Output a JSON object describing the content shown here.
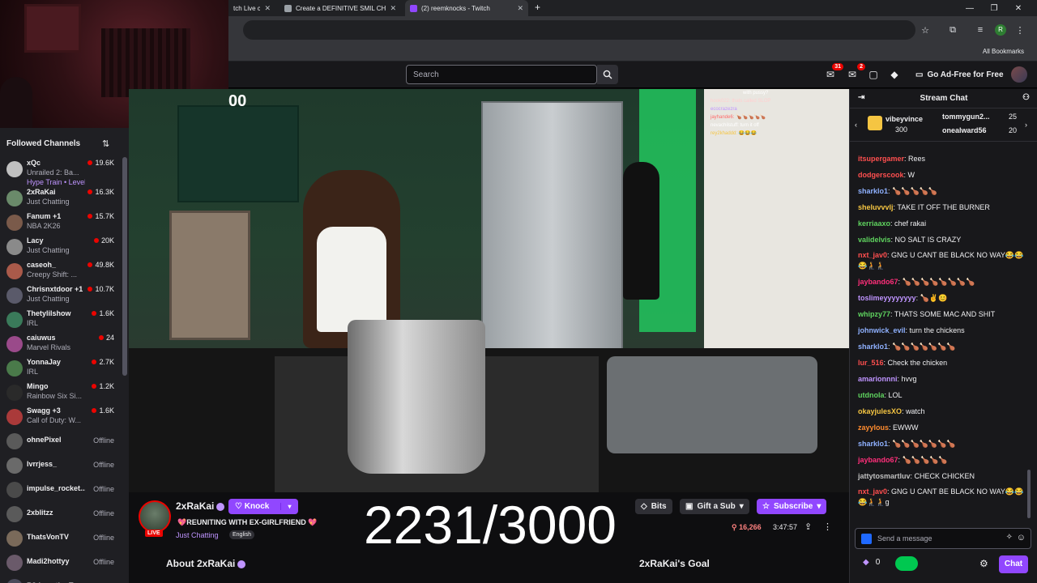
{
  "browser": {
    "tabs": [
      {
        "title": "tch Live c"
      },
      {
        "title": "Create a DEFINITIVE SMIL CHAR"
      },
      {
        "title": "(2) reemknocks - Twitch"
      }
    ],
    "all_bookmarks": "All Bookmarks",
    "profile_initial": "R"
  },
  "topnav": {
    "search_placeholder": "Search",
    "notif_badge_1": "31",
    "notif_badge_2": "2",
    "ad_free": "Go Ad-Free for Free"
  },
  "sidebar": {
    "title": "Followed Channels",
    "channels": [
      {
        "name": "xQc",
        "game": "Unrailed 2: Ba...",
        "viewers": "19.6K",
        "extra": "Hype Train • Level 2",
        "color": "#c0c0c0"
      },
      {
        "name": "2xRaKai",
        "game": "Just Chatting",
        "viewers": "16.3K",
        "color": "#6a8a6a"
      },
      {
        "name": "Fanum +1",
        "game": "NBA 2K26",
        "viewers": "15.7K",
        "color": "#7a5a4a"
      },
      {
        "name": "Lacy",
        "game": "Just Chatting",
        "viewers": "20K",
        "color": "#8a8a8a"
      },
      {
        "name": "caseoh_",
        "game": "Creepy Shift: ...",
        "viewers": "49.8K",
        "color": "#aa5a4a"
      },
      {
        "name": "Chrisnxtdoor +1",
        "game": "Just Chatting",
        "viewers": "10.7K",
        "color": "#5a5a6a"
      },
      {
        "name": "Thetylilshow",
        "game": "IRL",
        "viewers": "1.6K",
        "color": "#3a7a5a"
      },
      {
        "name": "caiuwus",
        "game": "Marvel Rivals",
        "viewers": "24",
        "color": "#9a4a8a"
      },
      {
        "name": "YonnaJay",
        "game": "IRL",
        "viewers": "2.7K",
        "color": "#4a7a4a"
      },
      {
        "name": "Mingo",
        "game": "Rainbow Six Si...",
        "viewers": "1.2K",
        "color": "#2a2a2a"
      },
      {
        "name": "Swagg +3",
        "game": "Call of Duty: W...",
        "viewers": "1.6K",
        "color": "#aa3a3a"
      },
      {
        "name": "ohnePixel",
        "offline": "Offline",
        "color": "#5a5a5a"
      },
      {
        "name": "lvrrjess_",
        "offline": "Offline",
        "color": "#6a6a6a"
      },
      {
        "name": "impulse_rocket...",
        "offline": "Offline",
        "color": "#4a4a4a"
      },
      {
        "name": "2xblitzz",
        "offline": "Offline",
        "color": "#5a5a5a"
      },
      {
        "name": "ThatsVonTV",
        "offline": "Offline",
        "color": "#7a6a5a"
      },
      {
        "name": "Madi2hottyy",
        "offline": "Offline",
        "color": "#6a5a6a"
      },
      {
        "name": "R3demptionT",
        "offline": "Offline",
        "color": "#4a4a5a"
      }
    ]
  },
  "video": {
    "corner_number": "00",
    "overlay_chat": [
      "with pussy?",
      "hook022: thats called SLOP",
      "ecocrazezra",
      "jayhande6: 🍗🍗🍗🍗🍗",
      "nevachilstuff: turn it off",
      "rey2khaddd: 😂😂😂"
    ]
  },
  "stream": {
    "streamer": "2xRaKai",
    "live": "LIVE",
    "knock": "Knock",
    "title": "💖REUNITING WITH EX-GIRLFRIEND 💖",
    "category": "Just Chatting",
    "language": "English",
    "big_counter": "2231/3000",
    "bits": "Bits",
    "gift_sub": "Gift a Sub",
    "subscribe": "Subscribe",
    "viewers": "16,266",
    "uptime": "3:47:57",
    "about": "About 2xRaKai",
    "goal": "2xRaKai's Goal"
  },
  "chat": {
    "header": "Stream Chat",
    "gifters": [
      {
        "name": "vibeyvince",
        "count": "300"
      },
      {
        "name": "tommygun2...",
        "count": "25"
      },
      {
        "name": "onealward56",
        "count": "20"
      }
    ],
    "messages": [
      {
        "user": "itsupergamer",
        "text": "Rees",
        "color": "#ff4f4f"
      },
      {
        "user": "dodgerscook",
        "text": "W",
        "color": "#ff4f4f"
      },
      {
        "user": "sharklo1",
        "text": "🍗🍗🍗🍗🍗",
        "color": "#8fb1ff"
      },
      {
        "user": "sheluvvvlj",
        "text": "TAKE IT OFF THE BURNER",
        "color": "#f5c542"
      },
      {
        "user": "kerriaaxo",
        "text": "chef rakai",
        "color": "#5fd35f"
      },
      {
        "user": "validelvis",
        "text": "NO SALT IS CRAZY",
        "color": "#5fd35f"
      },
      {
        "user": "nxt_jav0",
        "text": "GNG U CANT BE BLACK NO WAY😂😂😂🧎🧎",
        "color": "#ff4f4f"
      },
      {
        "user": "jaybando67",
        "text": "🍗🍗🍗🍗🍗🍗🍗🍗",
        "color": "#ff2f7a"
      },
      {
        "user": "toslimeyyyyyyyy",
        "text": "🍗✌😊",
        "color": "#bf94ff"
      },
      {
        "user": "whipzy77",
        "text": "THATS SOME MAC AND SHIT",
        "color": "#5fd35f"
      },
      {
        "user": "johnwick_evil",
        "text": "turn the chickens",
        "color": "#8fb1ff"
      },
      {
        "user": "sharklo1",
        "text": "🍗🍗🍗🍗🍗🍗🍗",
        "color": "#8fb1ff"
      },
      {
        "user": "lur_516",
        "text": "Check the chicken",
        "color": "#ff4f4f"
      },
      {
        "user": "amarionnni",
        "text": "hvvg",
        "color": "#bf94ff"
      },
      {
        "user": "utdnola",
        "text": "LOL",
        "color": "#5fd35f"
      },
      {
        "user": "okayjulesXO",
        "text": "watch",
        "color": "#f5c542"
      },
      {
        "user": "zayylous",
        "text": "EWWW",
        "color": "#ff8c2f"
      },
      {
        "user": "sharklo1",
        "text": "🍗🍗🍗🍗🍗🍗🍗",
        "color": "#8fb1ff"
      },
      {
        "user": "jaybando67",
        "text": "🍗🍗🍗🍗🍗",
        "color": "#ff2f7a"
      },
      {
        "user": "jattytosmartluv",
        "text": "CHECK CHICKEN",
        "color": "#c0c0c0"
      },
      {
        "user": "nxt_jav0",
        "text": "GNG U CANT BE BLACK NO WAY😂😂😂🧎🧎g",
        "color": "#ff4f4f"
      }
    ],
    "input_placeholder": "Send a message",
    "points": "0",
    "chat_button": "Chat"
  }
}
